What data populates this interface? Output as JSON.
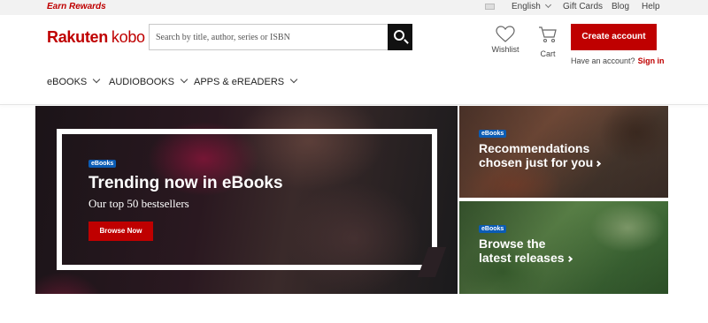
{
  "topbar": {
    "earn_rewards": "Earn Rewards",
    "language": "English",
    "gift_cards": "Gift Cards",
    "blog": "Blog",
    "help": "Help"
  },
  "header": {
    "logo_part1": "Rakuten",
    "logo_part2": "kobo",
    "search_placeholder": "Search by title, author, series or ISBN",
    "wishlist_label": "Wishlist",
    "cart_label": "Cart",
    "create_account": "Create account",
    "have_account": "Have an account?",
    "sign_in": "Sign in"
  },
  "nav": {
    "items": [
      {
        "label": "eBOOKS"
      },
      {
        "label": "AUDIOBOOKS"
      },
      {
        "label": "APPS & eREADERS"
      }
    ]
  },
  "hero": {
    "tag": "eBooks",
    "title": "Trending now in eBooks",
    "subtitle": "Our top 50 bestsellers",
    "button": "Browse Now"
  },
  "tiles": [
    {
      "tag": "eBooks",
      "line1": "Recommendations",
      "line2": "chosen just for you"
    },
    {
      "tag": "eBooks",
      "line1": "Browse the",
      "line2": "latest releases"
    }
  ],
  "colors": {
    "brand_red": "#bf0000",
    "tag_blue": "#0b5cb4",
    "topbar_bg": "#f2f2f2"
  }
}
